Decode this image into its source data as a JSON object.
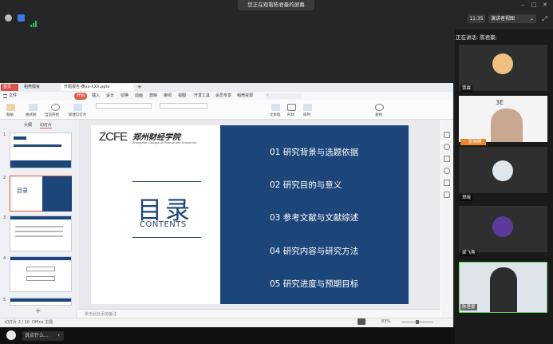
{
  "meeting": {
    "banner": "您正在观看陈君豪的屏幕",
    "time": "11:35",
    "view_mode": "演讲者视图",
    "speaking": "正在讲话: 陈君豪;",
    "chat_placeholder": "说点什么..."
  },
  "participants": [
    {
      "name": "贾霖"
    },
    {
      "name": "张晓婧"
    },
    {
      "name": "郑晓"
    },
    {
      "name": "梁飞燕"
    },
    {
      "name": "陈君豪"
    }
  ],
  "wps": {
    "tabs": [
      "首页",
      "稻壳模板",
      "开题报告-黄xx-XXX.pptx"
    ],
    "ribbon_tabs": [
      "文件",
      "开始",
      "插入",
      "设计",
      "切换",
      "动画",
      "放映",
      "审阅",
      "视图",
      "开发工具",
      "会员专享",
      "稻壳资源"
    ],
    "active_ribbon_tab": "开始",
    "ribbon_buttons": [
      "粘贴",
      "格式刷",
      "当前开始",
      "新建幻灯片",
      "文本框",
      "形状",
      "排列",
      "查找"
    ],
    "panel_tabs": [
      "大纲",
      "幻灯片"
    ],
    "thumb_numbers": [
      "1",
      "2",
      "3",
      "4",
      "5"
    ],
    "notes_placeholder": "单击此处添加备注",
    "status": {
      "slide_info": "幻灯片 2 / 10",
      "theme": "Office 主题",
      "zoom": "83%"
    }
  },
  "slide": {
    "logo_text": "ZCFE",
    "college_cn": "郑州财经学院",
    "college_en": "Zhengzhou College of Finance and Economics",
    "toc_title": "目录",
    "toc_subtitle": "CONTENTS",
    "items": [
      "01  研究背景与选题依据",
      "02  研究目的与意义",
      "03  参考文献与文献综述",
      "04  研究内容与研究方法",
      "05  研究进度与预期目标"
    ]
  },
  "colors": {
    "slide_blue": "#1c4579",
    "accent_red": "#e0523d"
  }
}
